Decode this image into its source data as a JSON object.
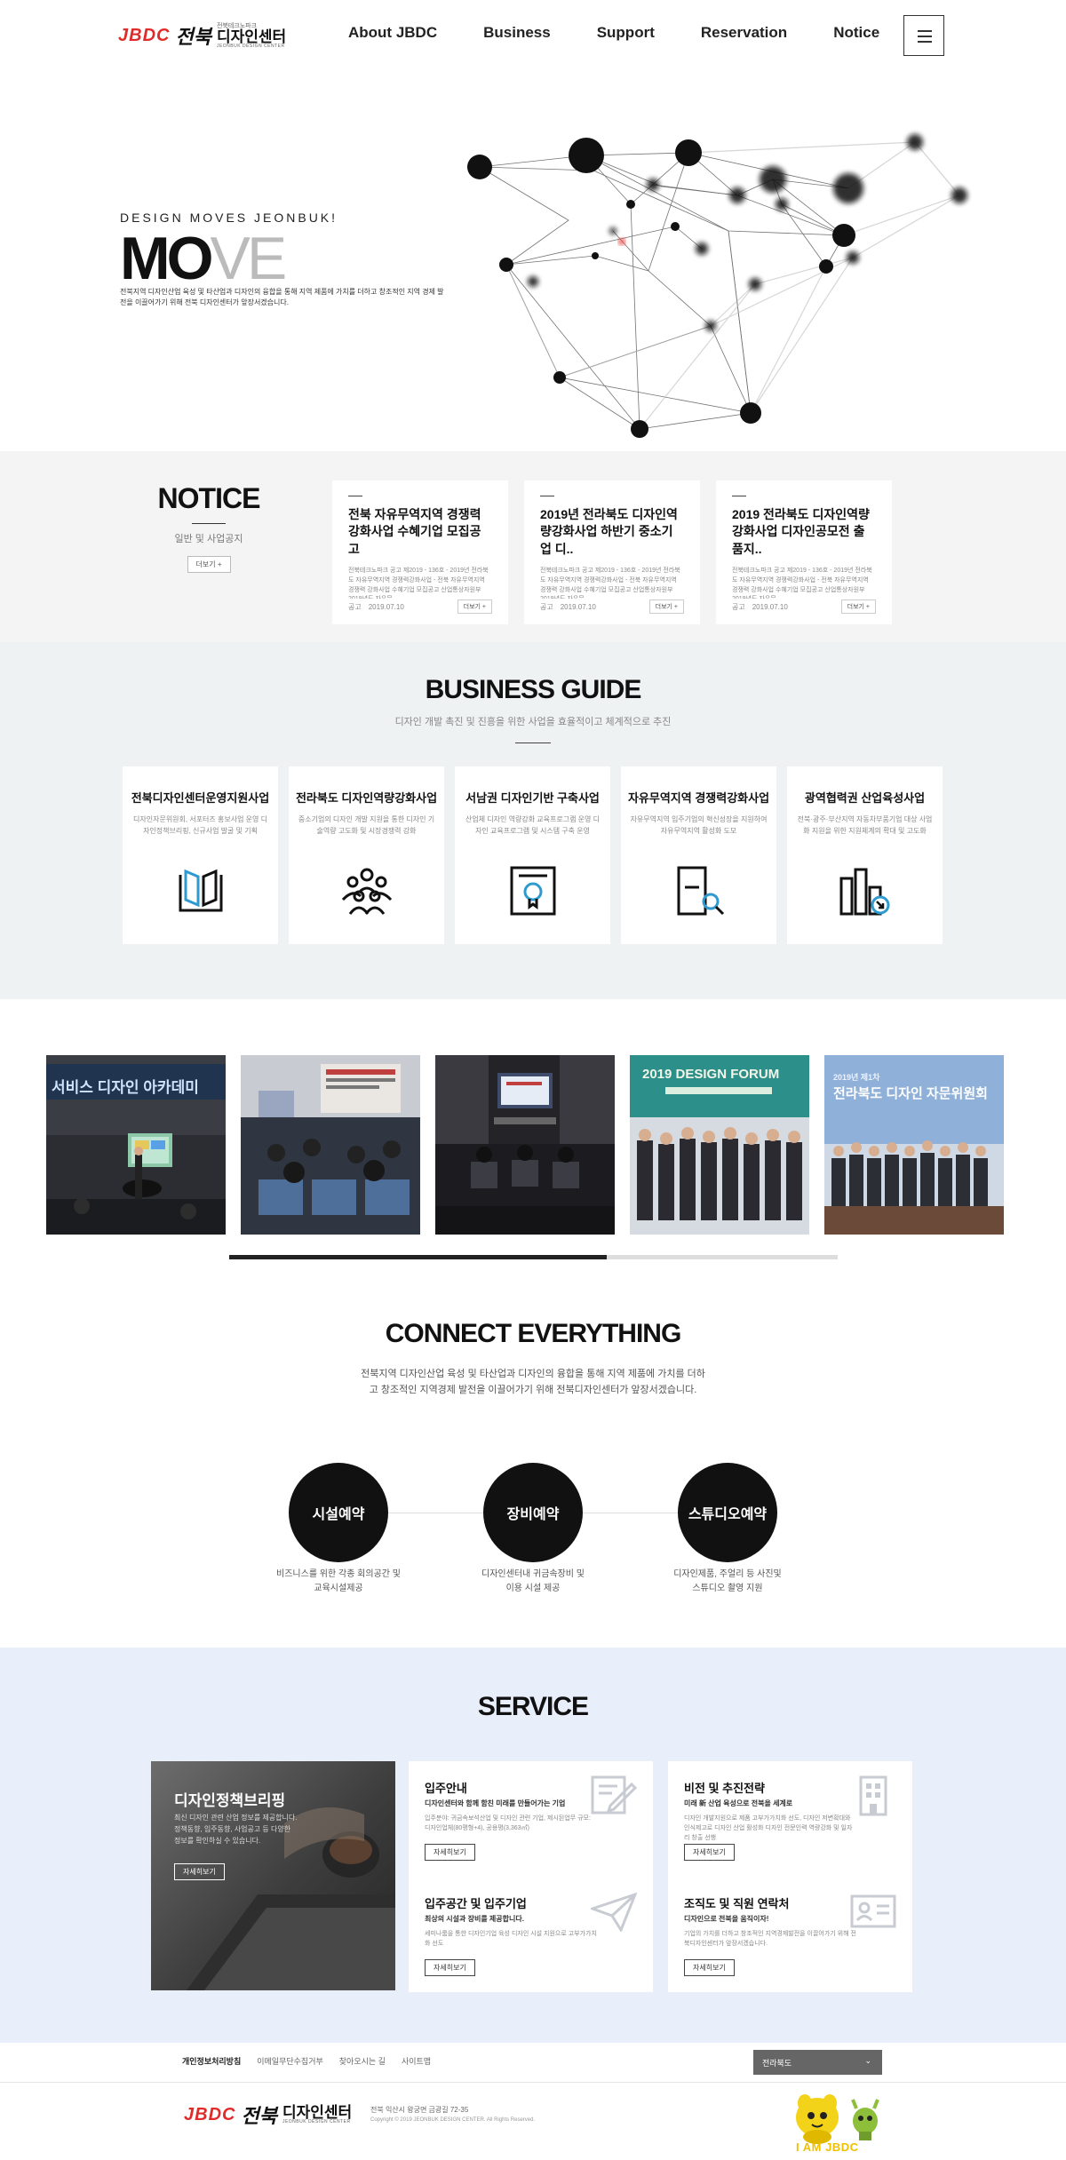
{
  "header": {
    "logo": {
      "latin": "JBDC",
      "brush": "전북",
      "top": "전북테크노파크",
      "main": "디자인센터",
      "sub": "JEONBUK DESIGN CENTER"
    },
    "nav": [
      "About JBDC",
      "Business",
      "Support",
      "Reservation",
      "Notice"
    ]
  },
  "hero": {
    "tagline": "DESIGN MOVES JEONBUK!",
    "title_a": "MO",
    "title_b": "VE",
    "description": "전북지역 디자인산업 육성 및 타산업과 디자인의 융합을 통해 지역 제품에 가치를 더하고 창조적인 지역 경제 발전을 이끌어가기 위해 전북 디자인센터가 앞장서겠습니다."
  },
  "notice": {
    "title": "NOTICE",
    "subtitle": "일반 및 사업공지",
    "more": "더보기",
    "items": [
      {
        "title": "전북 자유무역지역 경쟁력 강화사업 수혜기업 모집공고",
        "body": "전북테크노파크 공고 제2019 - 136호 - 2019년 전라북도 자유무역지역 경쟁력강화사업 - 전북 자유무역지역 경쟁력 강화사업 수혜기업 모집공고 산업통상자원부 2019년도 자유무",
        "category": "공고",
        "date": "2019.07.10",
        "more": "더보기"
      },
      {
        "title": "2019년 전라북도 디자인역량강화사업 하반기 중소기업 디..",
        "body": "전북테크노파크 공고 제2019 - 136호 - 2019년 전라북도 자유무역지역 경쟁력강화사업 - 전북 자유무역지역 경쟁력 강화사업 수혜기업 모집공고 산업통상자원부 2019년도 자유무",
        "category": "공고",
        "date": "2019.07.10",
        "more": "더보기"
      },
      {
        "title": "2019 전라북도 디자인역량강화사업 디자인공모전 출품지..",
        "body": "전북테크노파크 공고 제2019 - 136호 - 2019년 전라북도 자유무역지역 경쟁력강화사업 - 전북 자유무역지역 경쟁력 강화사업 수혜기업 모집공고 산업통상자원부 2019년도 자유무",
        "category": "공고",
        "date": "2019.07.10",
        "more": "더보기"
      }
    ]
  },
  "business": {
    "title": "BUSINESS GUIDE",
    "subtitle": "디자인 개발 촉진 및 진흥을 위한 사업을 효율적이고 체계적으로 추진",
    "items": [
      {
        "title": "전북디자인센터운영지원사업",
        "desc": "디자인자문위원회, 서포터즈 홍보사업 운영 디자인정책브리핑, 신규사업 발굴 및 기획",
        "icon": "book-icon"
      },
      {
        "title": "전라북도 디자인역량강화사업",
        "desc": "중소기업의 디자인 개발 지원을 통한 디자인 기술역량 고도화 및 시장경쟁력 강화",
        "icon": "people-group-icon"
      },
      {
        "title": "서남권 디자인기반 구축사업",
        "desc": "산업체 디자인 역량강화 교육프로그램 운영 디자인 교육프로그램 및 시스템 구축 운영",
        "icon": "certificate-icon"
      },
      {
        "title": "자유무역지역 경쟁력강화사업",
        "desc": "자유무역지역 입주기업의 혁신성장을 지원하여 자유무역지역 활성화 도모",
        "icon": "document-search-icon"
      },
      {
        "title": "광역협력권 산업육성사업",
        "desc": "전북·광주·부산지역 자동차부품기업 대상 사업화 지원을 위한 지원체계의 확대 및 고도화",
        "icon": "building-chart-icon"
      }
    ]
  },
  "gallery": {
    "photos": [
      {
        "name": "photo-seminar-presentation",
        "caption": "서비스 디자인 아카데미"
      },
      {
        "name": "photo-lecture-hall",
        "caption": ""
      },
      {
        "name": "photo-conference-room",
        "caption": ""
      },
      {
        "name": "photo-design-forum",
        "caption": "2019 DESIGN FORUM"
      },
      {
        "name": "photo-advisory-committee",
        "caption": "2019년 제1차 전라북도 디자인 자문위원회"
      }
    ],
    "progress": 0.62
  },
  "connect": {
    "title": "CONNECT EVERYTHING",
    "desc_line1": "전북지역 디자인산업 육성 및 타산업과 디자인의 융합을 통해 지역 제품에 가치를 더하",
    "desc_line2": "고 창조적인 지역경제 발전을 이끌어가기 위해 전북디자인센터가 앞장서겠습니다.",
    "items": [
      {
        "label": "시설예약",
        "cap1": "비즈니스를 위한 각종 회의공간 및",
        "cap2": "교육시설제공"
      },
      {
        "label": "장비예약",
        "cap1": "디자인센터내 귀금속장비 및",
        "cap2": "이용 시설 제공"
      },
      {
        "label": "스튜디오예약",
        "cap1": "디자인제품, 주얼리 등 사진및",
        "cap2": "스튜디오 촬영 지원"
      }
    ]
  },
  "service": {
    "title": "SERVICE",
    "feature": {
      "title": "디자인정책브리핑",
      "desc": "최신 디자인 관련 산업 정보를 제공합니다. 정책동향, 입주동향, 사업공고 등 다양한 정보를 확인하실 수 있습니다.",
      "btn": "자세히보기"
    },
    "cards": [
      {
        "title": "입주안내",
        "lead": "디자인센터와 함께 함친 미래를 만들어가는 기업",
        "body": "입주분야: 귀금속보석산업 및 디자인 관련 기업, 제시된업무 규모: 디자인업체(80평형+4), 공용평(3,363㎡)",
        "btn": "자세히보기",
        "icon": "edit-form-icon"
      },
      {
        "title": "비전 및 추진전략",
        "lead": "미래 新 산업 육성으로 전북을 세계로",
        "body": "디자인 개발지원으로 제품 고부가가치화 선도, 디자인 저변확대와 인식제고로 디자인 산업 활성화 디자인 전문인력 역량강화 및 일자리 창출 선행",
        "btn": "자세히보기",
        "icon": "building-icon"
      },
      {
        "title": "입주공간 및 입주기업",
        "lead": "최상의 시설과 장비를 제공합니다.",
        "body": "세미나룸을 통한 디자인기업 육성 디자인 시설 지원으로 고부가가치화 선도",
        "btn": "자세히보기",
        "icon": "paper-plane-icon"
      },
      {
        "title": "조직도 및 직원 연락처",
        "lead": "디자인으로 전북을 움직이자!",
        "body": "기업의 가치를 더하고 창조적인 지역경제발전을 이끌어가기 위해 전북디자인센터가 앞장서겠습니다.",
        "btn": "자세히보기",
        "icon": "id-card-icon"
      }
    ]
  },
  "footer": {
    "links": [
      "개인정보처리방침",
      "이메일무단수집거부",
      "찾아오시는 길",
      "사이트맵"
    ],
    "select": "전라북도",
    "address": "전북 익산시 왕궁면 금광길 72-35",
    "copyright": "Copyright © 2019 JEONBUK DESIGN CENTER. All Rights Reserved.",
    "mascot_text": "I AM JBDC"
  },
  "colors": {
    "brand_red": "#e02b2b",
    "mascot_yellow": "#f0c000",
    "dark": "#111111"
  }
}
